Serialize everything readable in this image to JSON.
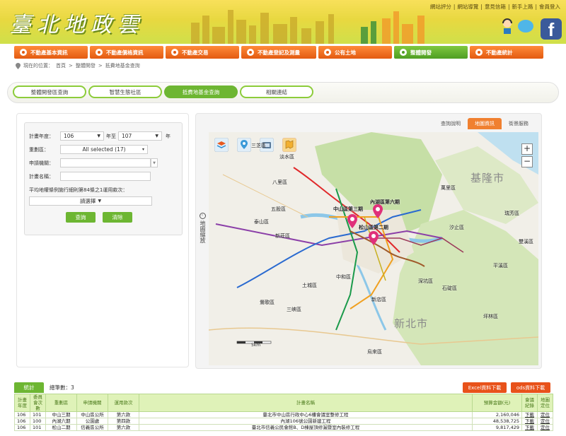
{
  "header": {
    "logo_text": "臺北地政雲",
    "top_links": [
      "網站評分",
      "網站導覽",
      "意見信箱",
      "新手上路",
      "會員登入"
    ]
  },
  "nav": {
    "items": [
      {
        "label": "不動產基本資訊",
        "active": false
      },
      {
        "label": "不動產價格資訊",
        "active": false
      },
      {
        "label": "不動產交易",
        "active": false
      },
      {
        "label": "不動產登記及測量",
        "active": false
      },
      {
        "label": "公有土地",
        "active": false
      },
      {
        "label": "整體開發",
        "active": true
      },
      {
        "label": "不動產統計",
        "active": false
      }
    ]
  },
  "breadcrumb": {
    "prefix": "現在的位置：",
    "items": [
      "首頁",
      "整體開發",
      "抵費地基金查詢"
    ],
    "separator": ">"
  },
  "subtabs": [
    {
      "label": "整體開發區查詢",
      "active": false
    },
    {
      "label": "智慧生態社區",
      "active": false
    },
    {
      "label": "抵費地基金查詢",
      "active": true
    },
    {
      "label": "相關連結",
      "active": false
    }
  ],
  "form": {
    "year_label": "計畫年度：",
    "year_from": "106",
    "year_to_label": "年至",
    "year_to": "107",
    "year_unit": "年",
    "district_label": "重劃區：",
    "district_value": "All selected (17)",
    "agency_label": "申請機關：",
    "agency_value": "",
    "plan_label": "計畫名稱：",
    "plan_value": "",
    "clause_label": "平均地權條例施行細則第84條之1運用款次：",
    "clause_value": "請選擇",
    "search_button": "查詢",
    "clear_button": "清除"
  },
  "map": {
    "tabs": [
      {
        "label": "查詢說明",
        "active": false
      },
      {
        "label": "地圖資訊",
        "active": true
      },
      {
        "label": "街景服務",
        "active": false
      }
    ],
    "toggle_label": "地圖縮放",
    "zoom_in": "+",
    "zoom_out": "−",
    "big_labels": [
      "基隆市",
      "新北市"
    ],
    "markers": [
      "內湖區第六期",
      "中山區第三期",
      "松山區第二期"
    ],
    "place_labels": [
      "萬里區",
      "瑞芳區",
      "汐止區",
      "淡水區",
      "三芝區",
      "八里區",
      "五股區",
      "泰山區",
      "新莊區",
      "土城區",
      "中和區",
      "新店區",
      "深坑區",
      "石碇區",
      "平溪區",
      "雙溪區",
      "坪林區",
      "烏來區",
      "三峽區",
      "鶯歌區"
    ],
    "scale_label": "5km",
    "toolbar_icons": [
      "layers-icon",
      "location-pin-icon",
      "street-view-icon",
      "map-legend-icon"
    ]
  },
  "results": {
    "tab_label": "統計",
    "count_text": "總筆數：3",
    "excel_button": "Excel資料下載",
    "ods_button": "ods資料下載",
    "columns": [
      "計畫年度",
      "委員會次數",
      "重劃區",
      "申請機關",
      "運用款次",
      "計畫名稱",
      "預算金額(元)",
      "會議紀錄",
      "地圖定位"
    ],
    "rows": [
      {
        "year": "106",
        "meeting": "101",
        "district": "中山三期",
        "agency": "中山區公所",
        "clause": "第六款",
        "plan": "臺北市中山區行政中心6樓會議室整修工程",
        "amount": "2,160,046",
        "record": "下載",
        "locate": "定位"
      },
      {
        "year": "106",
        "meeting": "100",
        "district": "內湖六期",
        "agency": "公園處",
        "clause": "第四款",
        "plan": "內湖106號公園新建工程",
        "amount": "48,538,725",
        "record": "下載",
        "locate": "定位"
      },
      {
        "year": "106",
        "meeting": "101",
        "district": "松山二期",
        "agency": "信義區公所",
        "clause": "第六款",
        "plan": "臺北市信義公民會館B、D棟屋頂修漏暨室內裝修工程",
        "amount": "9,817,429",
        "record": "下載",
        "locate": "定位"
      }
    ]
  },
  "colors": {
    "nav_orange": "#e35a10",
    "active_green": "#6db632",
    "header_yellow": "#e8d840"
  }
}
